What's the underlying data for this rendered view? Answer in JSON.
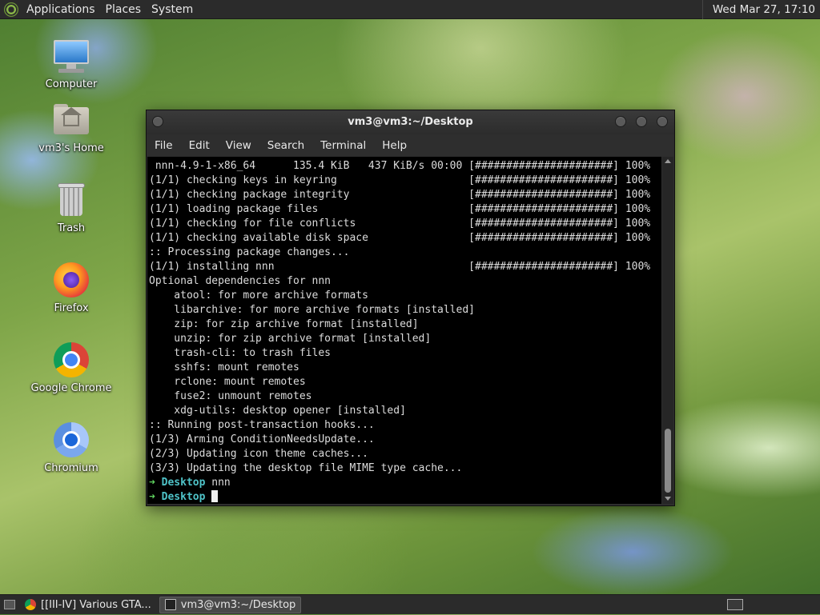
{
  "top_panel": {
    "menus": [
      "Applications",
      "Places",
      "System"
    ],
    "clock": "Wed Mar 27, 17:10"
  },
  "desktop_icons": [
    {
      "label": "Computer",
      "icon": "computer-icon"
    },
    {
      "label": "vm3's Home",
      "icon": "home-folder-icon"
    },
    {
      "label": "Trash",
      "icon": "trash-icon"
    },
    {
      "label": "Firefox",
      "icon": "firefox-icon"
    },
    {
      "label": "Google Chrome",
      "icon": "chrome-icon"
    },
    {
      "label": "Chromium",
      "icon": "chromium-icon"
    }
  ],
  "terminal": {
    "title": "vm3@vm3:~/Desktop",
    "menus": [
      "File",
      "Edit",
      "View",
      "Search",
      "Terminal",
      "Help"
    ],
    "lines": [
      " nnn-4.9-1-x86_64      135.4 KiB   437 KiB/s 00:00 [######################] 100%",
      "(1/1) checking keys in keyring                     [######################] 100%",
      "(1/1) checking package integrity                   [######################] 100%",
      "(1/1) loading package files                        [######################] 100%",
      "(1/1) checking for file conflicts                  [######################] 100%",
      "(1/1) checking available disk space                [######################] 100%",
      ":: Processing package changes...",
      "(1/1) installing nnn                               [######################] 100%",
      "Optional dependencies for nnn",
      "    atool: for more archive formats",
      "    libarchive: for more archive formats [installed]",
      "    zip: for zip archive format [installed]",
      "    unzip: for zip archive format [installed]",
      "    trash-cli: to trash files",
      "    sshfs: mount remotes",
      "    rclone: mount remotes",
      "    fuse2: unmount remotes",
      "    xdg-utils: desktop opener [installed]",
      ":: Running post-transaction hooks...",
      "(1/3) Arming ConditionNeedsUpdate...",
      "(2/3) Updating icon theme caches...",
      "(3/3) Updating the desktop file MIME type cache..."
    ],
    "prompts": [
      {
        "arrow": "➜",
        "dir": "Desktop",
        "command": " nnn"
      },
      {
        "arrow": "➜",
        "dir": "Desktop",
        "command": " "
      }
    ]
  },
  "taskbar": {
    "tasks": [
      {
        "label": "[[III-IV] Various GTA...",
        "icon": "chrome-icon",
        "active": false
      },
      {
        "label": "vm3@vm3:~/Desktop",
        "icon": "terminal-icon",
        "active": true
      }
    ]
  }
}
